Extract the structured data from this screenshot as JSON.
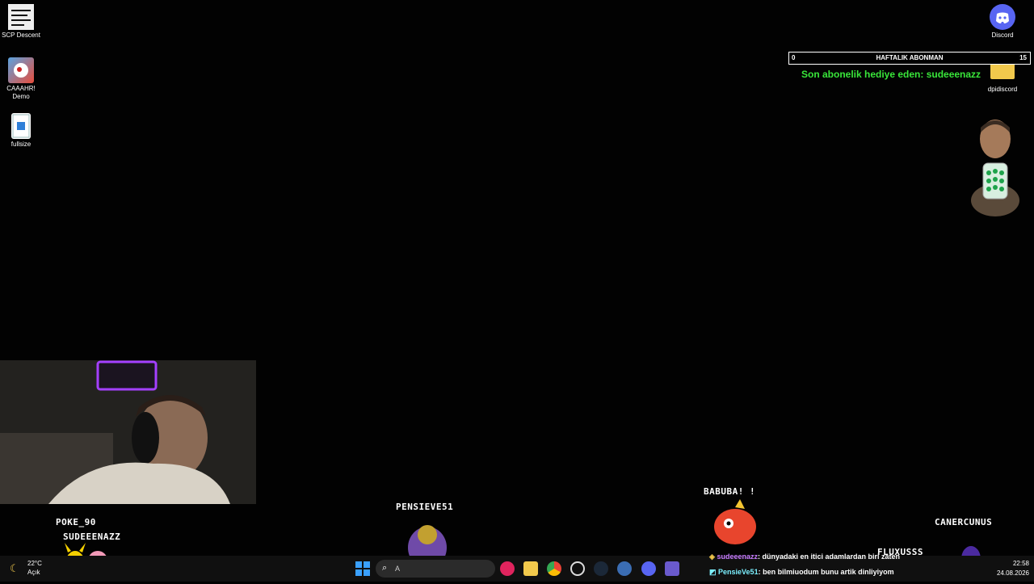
{
  "desktop": {
    "icons": [
      {
        "label": "SCP Descent"
      },
      {
        "label": "CAAAHR!\nDemo"
      },
      {
        "label": "fullsize"
      },
      {
        "label": "Discord"
      },
      {
        "label": "dpidiscord"
      }
    ]
  },
  "overlay": {
    "sub_left": "0",
    "sub_title": "HAFTALIK ABONMAN",
    "sub_right": "15",
    "sub_progress": 0.0,
    "gift_text": "Son abonelik hediye eden: sudeeenazz"
  },
  "viewers": [
    "POKE_90",
    "SUDEEENAZZ",
    "PENSIEVE51",
    "BABUBA! !",
    "CANERCUNUS",
    "FLUXUSSS"
  ],
  "chat": [
    {
      "user": "sudeeenazz",
      "text": ": dünyadaki en itici adamlardan biri zaten"
    },
    {
      "user": "PensieVe51",
      "text": ": ben bilmiuodum bunu artik dinliyiyom"
    }
  ],
  "taskbar": {
    "weather_temp": "22°C",
    "weather_desc": "Açık",
    "search_text": "A",
    "time": "22:58",
    "date": "24.08.2026"
  },
  "colors": {
    "gift_green": "#39e63a",
    "chat_user1": "#c77bff",
    "chat_user2": "#7cf0ff"
  }
}
